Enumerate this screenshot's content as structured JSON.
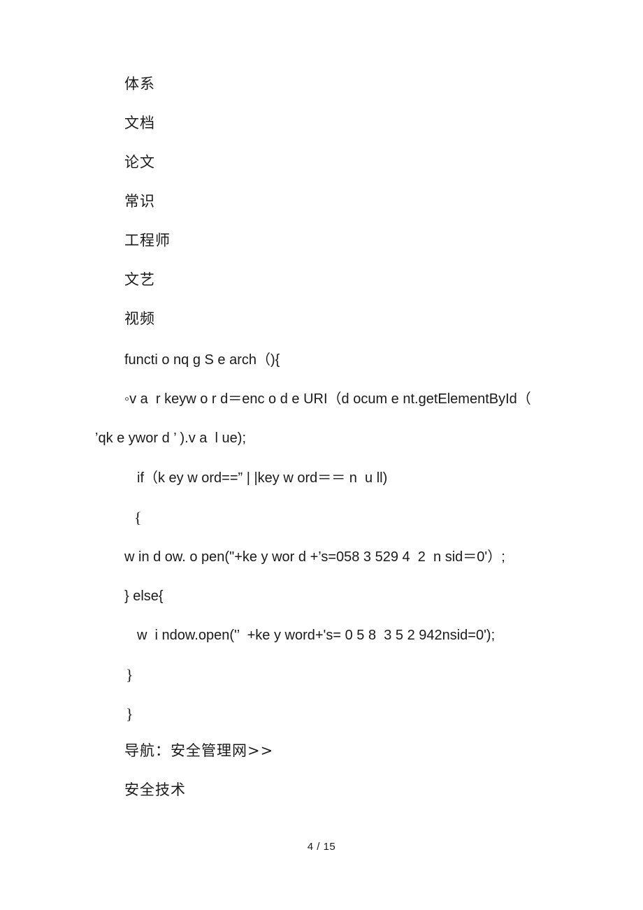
{
  "document": {
    "page_label": "4 / 15",
    "lines": [
      {
        "id": "l1",
        "text": "体系"
      },
      {
        "id": "l2",
        "text": "文档"
      },
      {
        "id": "l3",
        "text": "论文"
      },
      {
        "id": "l4",
        "text": "常识"
      },
      {
        "id": "l5",
        "text": "工程师"
      },
      {
        "id": "l6",
        "text": "文艺"
      },
      {
        "id": "l7",
        "text": "视频"
      },
      {
        "id": "l8",
        "text": "functi o nq g S e arch（){"
      },
      {
        "id": "l9",
        "text": "◦v a  r keyw o r d＝enc o d e URI（d ocum e nt.getElementById（"
      },
      {
        "id": "l10",
        "text": "’qk e ywor d ’ ).v a  l ue);"
      },
      {
        "id": "l11",
        "text": "if（k ey w ord==” | |key w ord＝＝ n  u ll)"
      },
      {
        "id": "l12",
        "text": "{"
      },
      {
        "id": "l13",
        "text": "w in d ow. o pen(\"+ke y wor d +’s=058 3 529 4  2  n sid＝0'）;"
      },
      {
        "id": "l14",
        "text": "} else{"
      },
      {
        "id": "l15",
        "text": "w  i ndow.open('’  +ke y word+'s= 0 5 8  3 5 2 942nsid=0');"
      },
      {
        "id": "l16",
        "text": "}"
      },
      {
        "id": "l17",
        "text": "}"
      },
      {
        "id": "l18",
        "text": "导航：安全管理网>>"
      },
      {
        "id": "l19",
        "text": "安全技术"
      }
    ]
  },
  "colors": {
    "text": "#1a1a1a",
    "background": "#ffffff"
  }
}
